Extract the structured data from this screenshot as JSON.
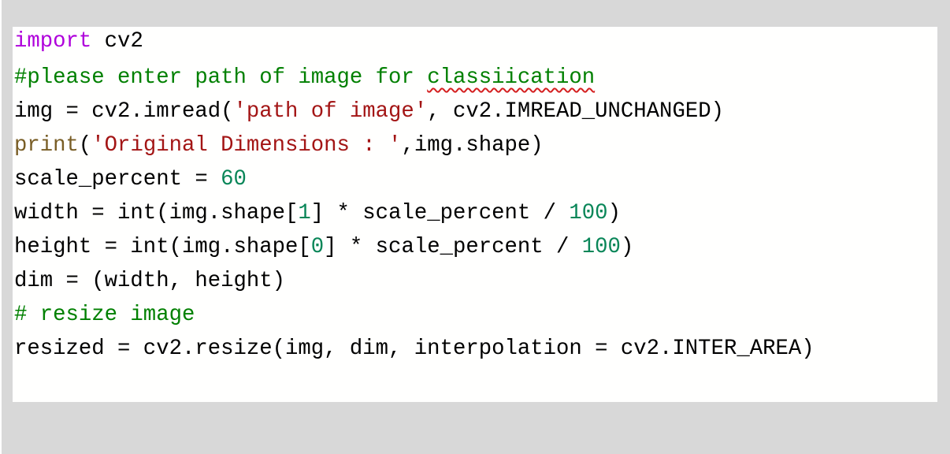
{
  "editor": {
    "lines": [
      {
        "tokens": [
          {
            "t": "import",
            "k": "kw"
          },
          {
            "t": " cv2",
            "k": ""
          }
        ]
      },
      {
        "tokens": [
          {
            "t": "#please enter path of image for ",
            "k": "cm"
          },
          {
            "t": "classiication",
            "k": "cm spell"
          }
        ]
      },
      {
        "tokens": [
          {
            "t": "img = cv2.imread(",
            "k": ""
          },
          {
            "t": "'path of image'",
            "k": "str"
          },
          {
            "t": ", cv2.IMREAD_UNCHANGED)",
            "k": ""
          }
        ]
      },
      {
        "tokens": [
          {
            "t": "print",
            "k": "fn"
          },
          {
            "t": "(",
            "k": ""
          },
          {
            "t": "'Original Dimensions : '",
            "k": "str"
          },
          {
            "t": ",img.shape)",
            "k": ""
          }
        ]
      },
      {
        "tokens": [
          {
            "t": "scale_percent = ",
            "k": ""
          },
          {
            "t": "60",
            "k": "num"
          }
        ]
      },
      {
        "tokens": [
          {
            "t": "width = int(img.shape[",
            "k": ""
          },
          {
            "t": "1",
            "k": "num"
          },
          {
            "t": "] * scale_percent / ",
            "k": ""
          },
          {
            "t": "100",
            "k": "num"
          },
          {
            "t": ")",
            "k": ""
          }
        ]
      },
      {
        "tokens": [
          {
            "t": "height = int(img.shape[",
            "k": ""
          },
          {
            "t": "0",
            "k": "num"
          },
          {
            "t": "] * scale_percent / ",
            "k": ""
          },
          {
            "t": "100",
            "k": "num"
          },
          {
            "t": ")",
            "k": ""
          }
        ]
      },
      {
        "tokens": [
          {
            "t": "dim = (width, height)",
            "k": ""
          }
        ]
      },
      {
        "tokens": [
          {
            "t": "# resize image",
            "k": "cm"
          }
        ]
      },
      {
        "tokens": [
          {
            "t": "resized = cv2.resize(img, dim, interpolation = cv2.INTER_AREA)",
            "k": ""
          }
        ]
      }
    ],
    "misspelled_word": "classiication",
    "colors": {
      "keyword": "#af00db",
      "comment": "#008000",
      "string": "#a31515",
      "function": "#795e26",
      "number": "#098658",
      "spellcheck": "#d41f1f"
    }
  }
}
